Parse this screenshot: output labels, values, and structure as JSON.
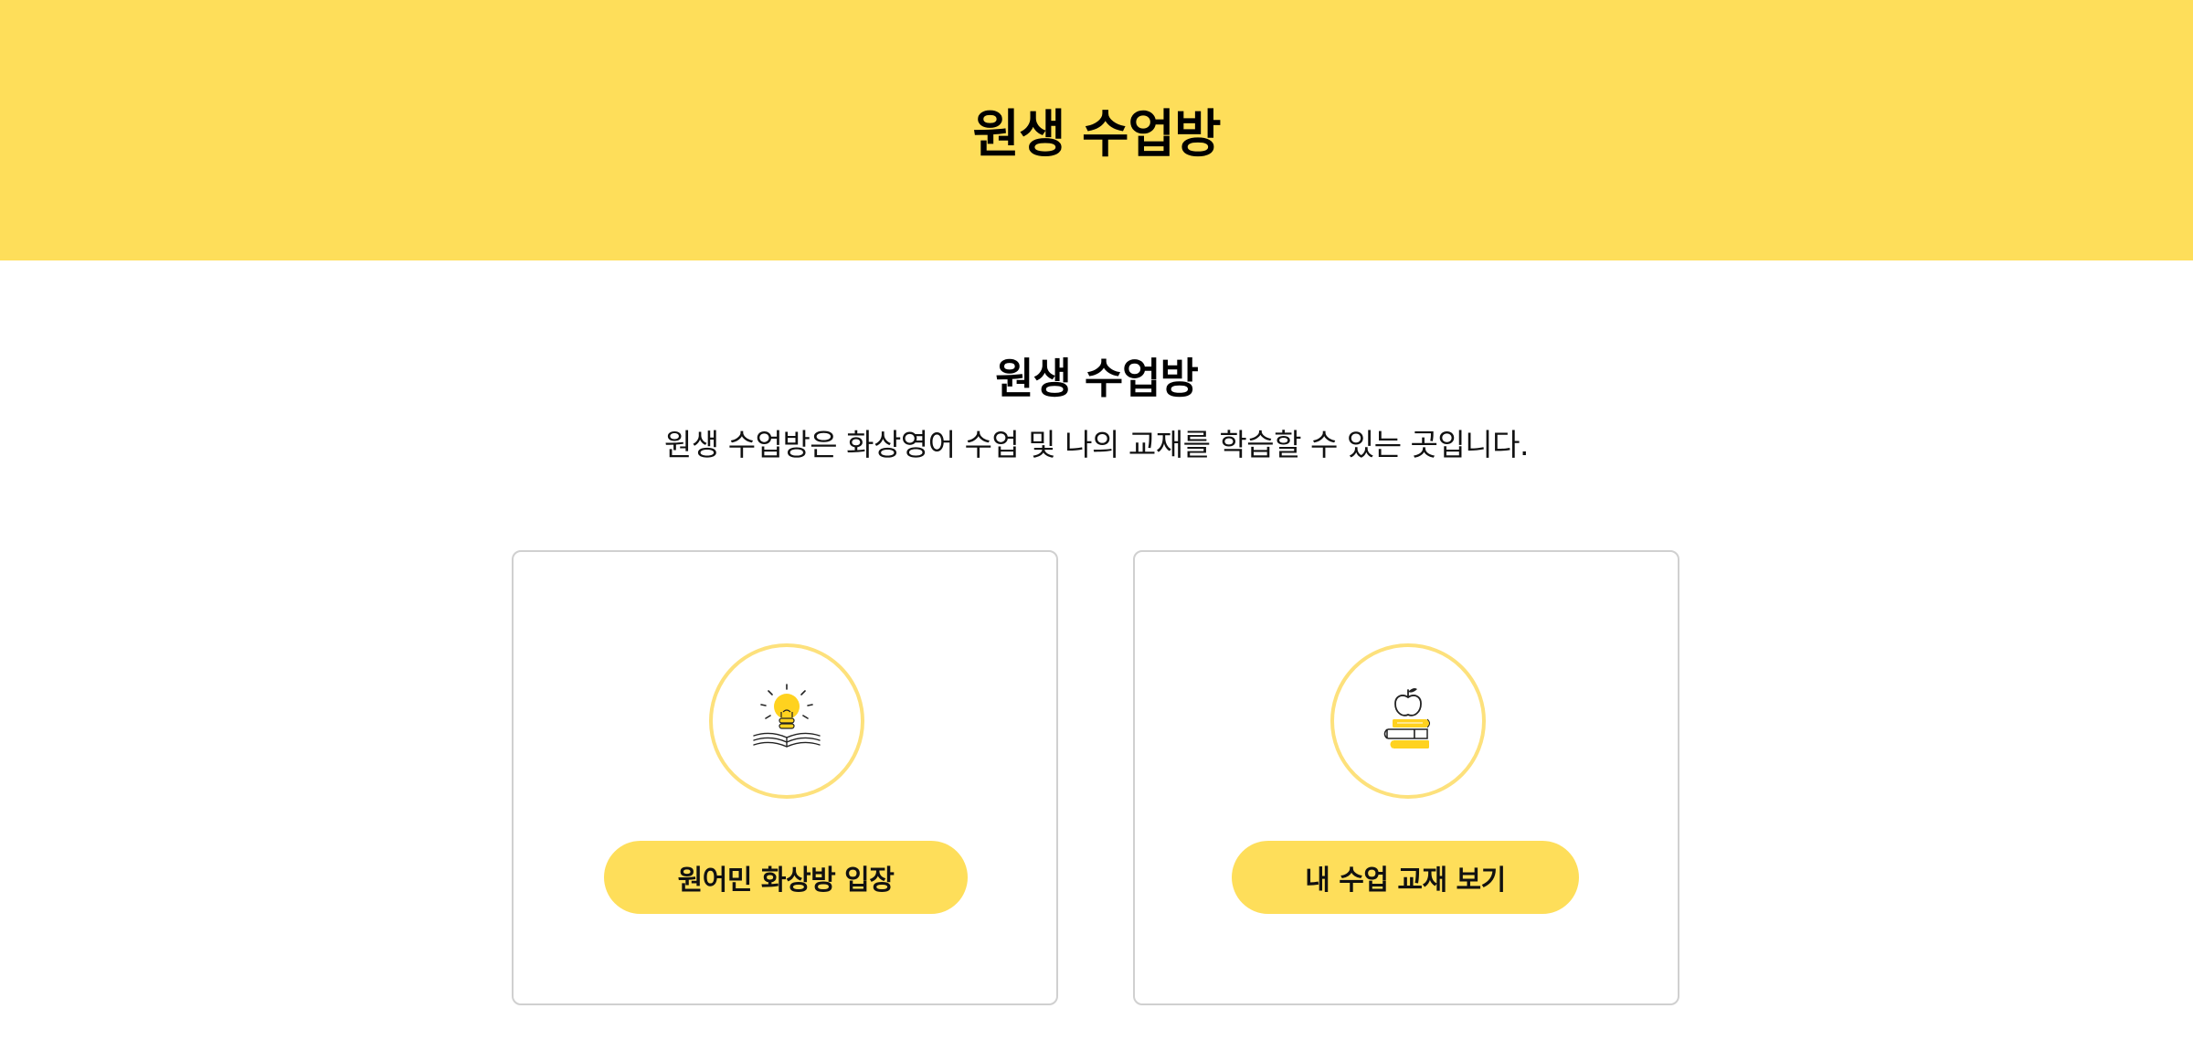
{
  "header": {
    "title": "원생 수업방"
  },
  "intro": {
    "title": "원생 수업방",
    "description": "원생 수업방은 화상영어 수업 및 나의 교재를 학습할 수 있는 곳입니다."
  },
  "cards": [
    {
      "icon": "lightbulb-book-icon",
      "button_label": "원어민 화상방 입장"
    },
    {
      "icon": "apple-books-icon",
      "button_label": "내 수업 교재 보기"
    }
  ],
  "colors": {
    "accent": "#FEDE5A",
    "icon_ring": "#FDE17C",
    "card_border": "#d0d0d0",
    "text": "#111111"
  }
}
